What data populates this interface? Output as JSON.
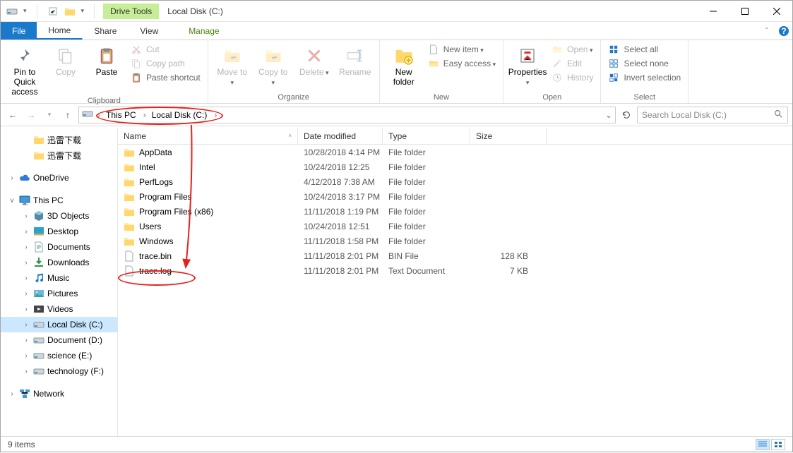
{
  "window": {
    "title": "Local Disk (C:)",
    "contextual_tab": "Drive Tools"
  },
  "menu": {
    "file": "File",
    "home": "Home",
    "share": "Share",
    "view": "View",
    "manage": "Manage"
  },
  "ribbon": {
    "clipboard": {
      "label": "Clipboard",
      "pin": "Pin to Quick access",
      "copy": "Copy",
      "paste": "Paste",
      "cut": "Cut",
      "copy_path": "Copy path",
      "paste_shortcut": "Paste shortcut"
    },
    "organize": {
      "label": "Organize",
      "move_to": "Move to",
      "copy_to": "Copy to",
      "delete": "Delete",
      "rename": "Rename"
    },
    "new": {
      "label": "New",
      "new_folder": "New folder",
      "new_item": "New item",
      "easy_access": "Easy access"
    },
    "open": {
      "label": "Open",
      "properties": "Properties",
      "open": "Open",
      "edit": "Edit",
      "history": "History"
    },
    "select": {
      "label": "Select",
      "select_all": "Select all",
      "select_none": "Select none",
      "invert": "Invert selection"
    }
  },
  "address": {
    "crumbs": [
      "This PC",
      "Local Disk (C:)"
    ]
  },
  "search": {
    "placeholder": "Search Local Disk (C:)"
  },
  "tree": {
    "items": [
      {
        "kind": "folder",
        "label": "迅雷下载",
        "twisty": "",
        "depth": 1
      },
      {
        "kind": "folder",
        "label": "迅雷下载",
        "twisty": "",
        "depth": 1
      },
      {
        "kind": "sep"
      },
      {
        "kind": "onedrive",
        "label": "OneDrive",
        "twisty": "›",
        "depth": 0
      },
      {
        "kind": "sep"
      },
      {
        "kind": "thispc",
        "label": "This PC",
        "twisty": "v",
        "depth": 0
      },
      {
        "kind": "3d",
        "label": "3D Objects",
        "twisty": "›",
        "depth": 1
      },
      {
        "kind": "desktop",
        "label": "Desktop",
        "twisty": "›",
        "depth": 1
      },
      {
        "kind": "documents",
        "label": "Documents",
        "twisty": "›",
        "depth": 1
      },
      {
        "kind": "downloads",
        "label": "Downloads",
        "twisty": "›",
        "depth": 1
      },
      {
        "kind": "music",
        "label": "Music",
        "twisty": "›",
        "depth": 1
      },
      {
        "kind": "pictures",
        "label": "Pictures",
        "twisty": "›",
        "depth": 1
      },
      {
        "kind": "videos",
        "label": "Videos",
        "twisty": "›",
        "depth": 1
      },
      {
        "kind": "disk",
        "label": "Local Disk (C:)",
        "twisty": "›",
        "depth": 1,
        "selected": true
      },
      {
        "kind": "disk",
        "label": "Document (D:)",
        "twisty": "›",
        "depth": 1
      },
      {
        "kind": "disk",
        "label": "science (E:)",
        "twisty": "›",
        "depth": 1
      },
      {
        "kind": "disk",
        "label": "technology (F:)",
        "twisty": "›",
        "depth": 1
      },
      {
        "kind": "sep"
      },
      {
        "kind": "network",
        "label": "Network",
        "twisty": "›",
        "depth": 0
      }
    ]
  },
  "columns": {
    "name": "Name",
    "date": "Date modified",
    "type": "Type",
    "size": "Size"
  },
  "files": [
    {
      "icon": "folder",
      "name": "AppData",
      "date": "10/28/2018 4:14 PM",
      "type": "File folder",
      "size": ""
    },
    {
      "icon": "folder",
      "name": "Intel",
      "date": "10/24/2018 12:25",
      "type": "File folder",
      "size": ""
    },
    {
      "icon": "folder",
      "name": "PerfLogs",
      "date": "4/12/2018 7:38 AM",
      "type": "File folder",
      "size": ""
    },
    {
      "icon": "folder",
      "name": "Program Files",
      "date": "10/24/2018 3:17 PM",
      "type": "File folder",
      "size": ""
    },
    {
      "icon": "folder",
      "name": "Program Files (x86)",
      "date": "11/11/2018 1:19 PM",
      "type": "File folder",
      "size": ""
    },
    {
      "icon": "folder",
      "name": "Users",
      "date": "10/24/2018 12:51",
      "type": "File folder",
      "size": ""
    },
    {
      "icon": "folder",
      "name": "Windows",
      "date": "11/11/2018 1:58 PM",
      "type": "File folder",
      "size": ""
    },
    {
      "icon": "file",
      "name": "trace.bin",
      "date": "11/11/2018 2:01 PM",
      "type": "BIN File",
      "size": "128 KB"
    },
    {
      "icon": "file",
      "name": "trace.log",
      "date": "11/11/2018 2:01 PM",
      "type": "Text Document",
      "size": "7 KB"
    }
  ],
  "status": {
    "count": "9 items"
  }
}
